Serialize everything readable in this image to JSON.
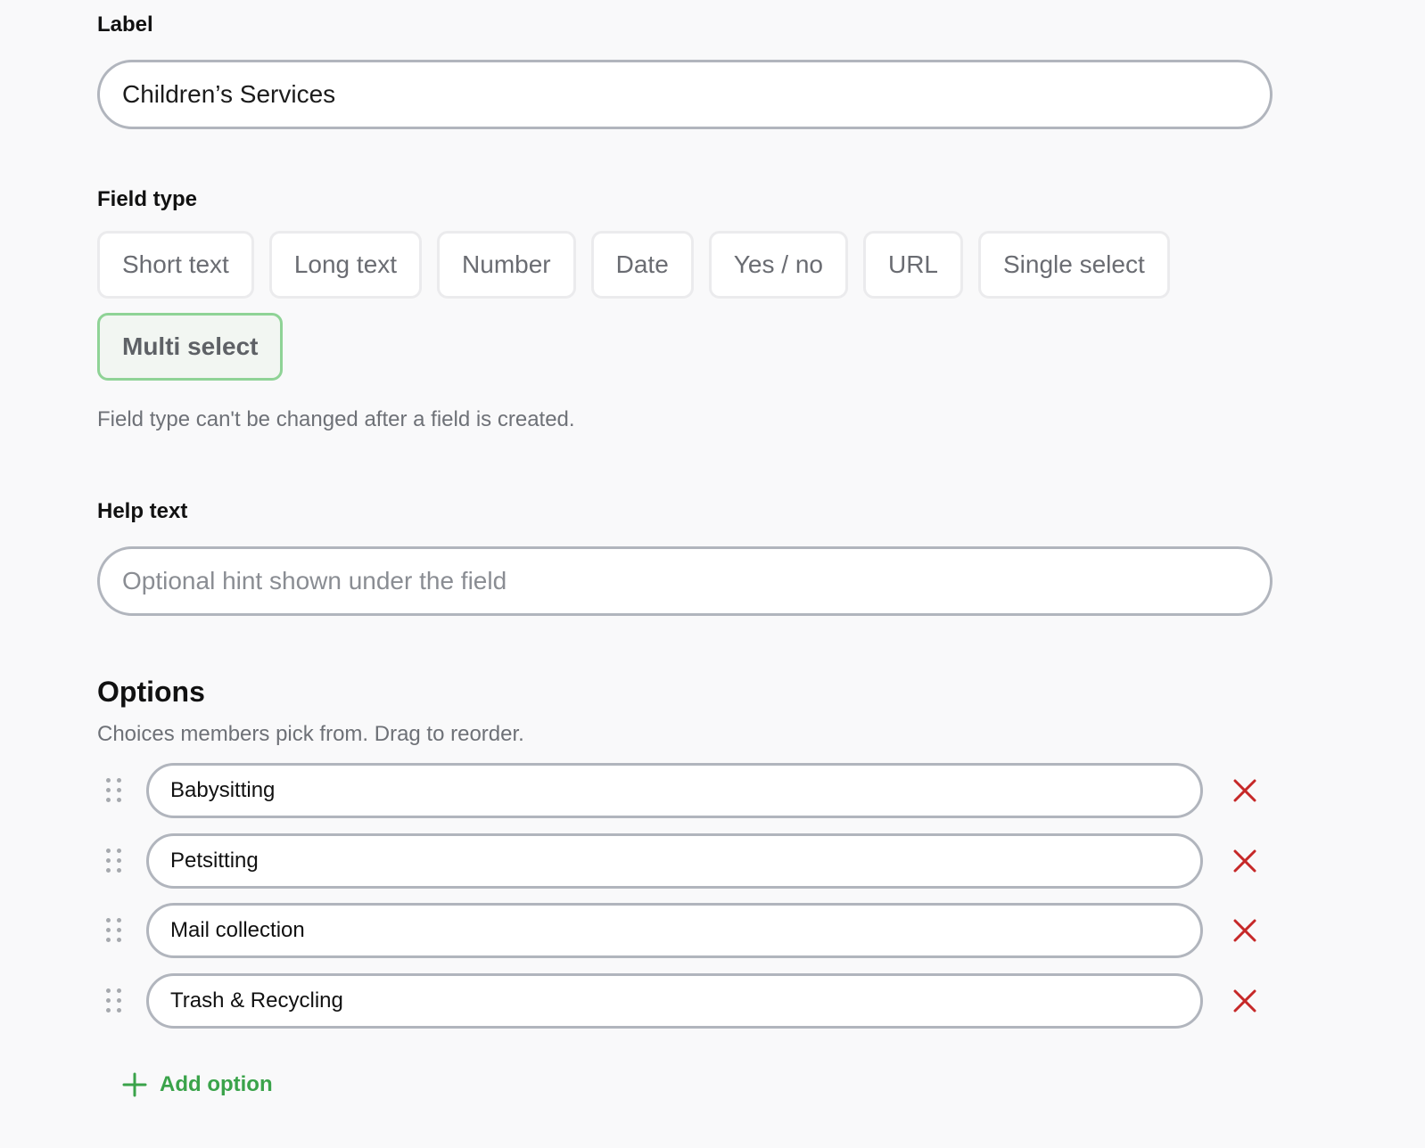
{
  "label_section": {
    "heading": "Label",
    "value": "Children’s Services"
  },
  "field_type": {
    "heading": "Field type",
    "options": [
      {
        "label": "Short text",
        "selected": false
      },
      {
        "label": "Long text",
        "selected": false
      },
      {
        "label": "Number",
        "selected": false
      },
      {
        "label": "Date",
        "selected": false
      },
      {
        "label": "Yes / no",
        "selected": false
      },
      {
        "label": "URL",
        "selected": false
      },
      {
        "label": "Single select",
        "selected": false
      },
      {
        "label": "Multi select",
        "selected": true
      }
    ],
    "note": "Field type can't be changed after a field is created."
  },
  "help_text": {
    "heading": "Help text",
    "value": "",
    "placeholder": "Optional hint shown under the field"
  },
  "options_section": {
    "title": "Options",
    "description": "Choices members pick from. Drag to reorder.",
    "items": [
      {
        "value": "Babysitting"
      },
      {
        "value": "Petsitting"
      },
      {
        "value": "Mail collection"
      },
      {
        "value": "Trash & Recycling"
      }
    ],
    "add_label": "Add option"
  },
  "icons": {
    "drag": "drag-handle-icon",
    "remove": "close-icon",
    "add": "plus-icon"
  },
  "colors": {
    "accent_green": "#3aa34a",
    "selected_border": "#8fd396",
    "remove_red": "#c62828",
    "input_border": "#b1b5bd"
  }
}
